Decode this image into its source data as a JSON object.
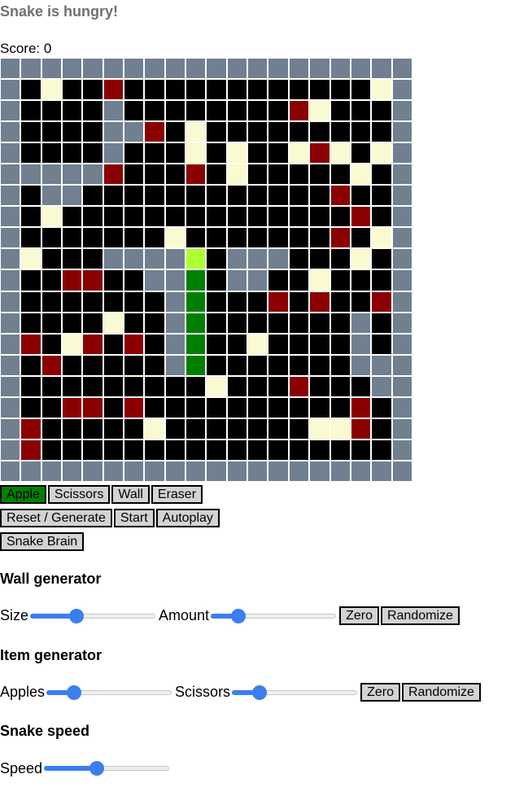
{
  "status": "Snake is hungry!",
  "score_label": "Score: 0",
  "colors": {
    "empty": "#000000",
    "wall": "#708090",
    "scissors": "#8b0000",
    "apple": "#fafad2",
    "snake_body": "#008000",
    "snake_head": "#adff2f",
    "selected_tool": "#008000"
  },
  "board": {
    "columns": 20,
    "rows": 20,
    "grid": [
      "11111111111111111111",
      "10300200000000000031",
      "10000100000000230001",
      "10000112030000000001",
      "10000100030300323031",
      "11111200020300000301",
      "10110000000000002001",
      "10300000000000000201",
      "10000000300000002031",
      "13000111150111000301",
      "10022001140110030001",
      "10000000140002020021",
      "10000300140000000101",
      "12032020140030000101",
      "10200000140000000111",
      "10000000003000200011",
      "10022020000000000201",
      "12000003000000033201",
      "12000000000000000001",
      "11111111111111111111"
    ]
  },
  "tools": {
    "apple": "Apple",
    "scissors": "Scissors",
    "wall": "Wall",
    "eraser": "Eraser",
    "selected": "Apple"
  },
  "actions": {
    "reset": "Reset / Generate",
    "start": "Start",
    "autoplay": "Autoplay",
    "brain": "Snake Brain"
  },
  "wall_generator": {
    "heading": "Wall generator",
    "size_label": "Size",
    "size_value": 0.37,
    "amount_label": "Amount",
    "amount_value": 0.22,
    "zero": "Zero",
    "randomize": "Randomize"
  },
  "item_generator": {
    "heading": "Item generator",
    "apples_label": "Apples",
    "apples_value": 0.22,
    "scissors_label": "Scissors",
    "scissors_value": 0.22,
    "zero": "Zero",
    "randomize": "Randomize"
  },
  "snake_speed": {
    "heading": "Snake speed",
    "speed_label": "Speed",
    "speed_value": 0.42
  }
}
